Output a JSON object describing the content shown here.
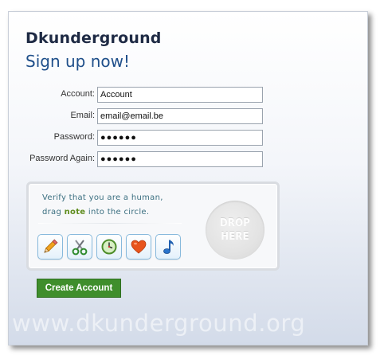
{
  "brand": "Dkunderground",
  "subtitle": "Sign up now!",
  "form": {
    "account_label": "Account:",
    "account_value": "Account",
    "email_label": "Email:",
    "email_value": "email@email.be",
    "password_label": "Password:",
    "password_value": "●●●●●●",
    "password_again_label": "Password Again:",
    "password_again_value": "●●●●●●"
  },
  "captcha": {
    "line1": "Verify that you are a human,",
    "line2_prefix": "drag ",
    "line2_highlight": "note",
    "line2_suffix": " into the circle.",
    "drop_line1": "DROP",
    "drop_line2": "HERE",
    "icons": [
      "pencil-icon",
      "scissors-icon",
      "clock-icon",
      "heart-icon",
      "music-note-icon"
    ],
    "highlight_color": "#5f8d1e"
  },
  "create_button": "Create Account",
  "watermark": "www.dkunderground.org",
  "colors": {
    "button_green": "#3f8e2c",
    "title_blue": "#1f4f8a",
    "icon_border": "#87b9dc"
  }
}
